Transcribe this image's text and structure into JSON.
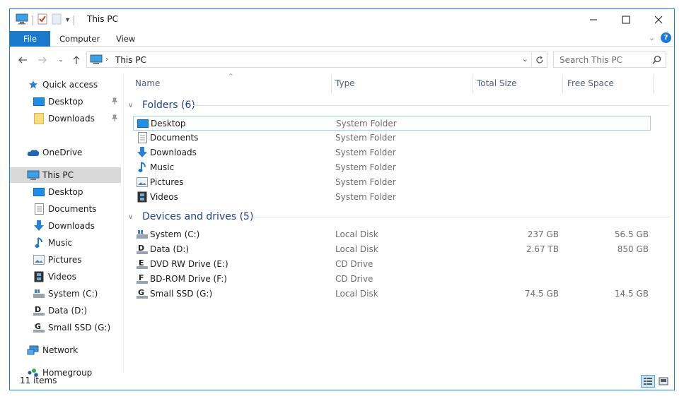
{
  "window": {
    "title": "This PC"
  },
  "ribbon": {
    "tabs": [
      "File",
      "Computer",
      "View"
    ]
  },
  "address": {
    "location": "This PC",
    "search_placeholder": "Search This PC"
  },
  "nav": {
    "items": [
      {
        "label": "Quick access",
        "icon": "star-icon"
      },
      {
        "label": "Desktop",
        "icon": "desktop-folder-icon",
        "pinned": true
      },
      {
        "label": "Downloads",
        "icon": "folder-icon",
        "pinned": true
      },
      {
        "label": "OneDrive",
        "icon": "cloud-icon"
      },
      {
        "label": "This PC",
        "icon": "computer-icon",
        "selected": true
      },
      {
        "label": "Desktop",
        "icon": "desktop-folder-icon"
      },
      {
        "label": "Documents",
        "icon": "documents-icon"
      },
      {
        "label": "Downloads",
        "icon": "download-arrow-icon"
      },
      {
        "label": "Music",
        "icon": "music-note-icon"
      },
      {
        "label": "Pictures",
        "icon": "pictures-icon"
      },
      {
        "label": "Videos",
        "icon": "film-icon"
      },
      {
        "label": "System (C:)",
        "icon": "system-drive-icon"
      },
      {
        "label": "Data (D:)",
        "icon": "drive-d-icon"
      },
      {
        "label": "Small SSD (G:)",
        "icon": "drive-g-icon"
      },
      {
        "label": "Network",
        "icon": "network-icon"
      },
      {
        "label": "Homegroup",
        "icon": "homegroup-icon"
      }
    ]
  },
  "columns": {
    "name": "Name",
    "type": "Type",
    "total_size": "Total Size",
    "free_space": "Free Space"
  },
  "groups": {
    "folders": {
      "title": "Folders (6)",
      "items": [
        {
          "name": "Desktop",
          "type": "System Folder",
          "icon": "desktop-folder-icon"
        },
        {
          "name": "Documents",
          "type": "System Folder",
          "icon": "documents-icon"
        },
        {
          "name": "Downloads",
          "type": "System Folder",
          "icon": "download-arrow-icon"
        },
        {
          "name": "Music",
          "type": "System Folder",
          "icon": "music-note-icon"
        },
        {
          "name": "Pictures",
          "type": "System Folder",
          "icon": "pictures-icon"
        },
        {
          "name": "Videos",
          "type": "System Folder",
          "icon": "film-icon"
        }
      ]
    },
    "drives": {
      "title": "Devices and drives (5)",
      "items": [
        {
          "name": "System (C:)",
          "type": "Local Disk",
          "total": "237 GB",
          "free": "56.5 GB",
          "icon": "system-drive-icon"
        },
        {
          "name": "Data (D:)",
          "type": "Local Disk",
          "total": "2.67 TB",
          "free": "850 GB",
          "icon": "drive-d-icon"
        },
        {
          "name": "DVD RW Drive (E:)",
          "type": "CD Drive",
          "total": "",
          "free": "",
          "icon": "drive-e-icon"
        },
        {
          "name": "BD-ROM Drive (F:)",
          "type": "CD Drive",
          "total": "",
          "free": "",
          "icon": "drive-f-icon"
        },
        {
          "name": "Small SSD (G:)",
          "type": "Local Disk",
          "total": "74.5 GB",
          "free": "14.5 GB",
          "icon": "drive-g-icon"
        }
      ]
    }
  },
  "status": {
    "count": "11 items"
  },
  "colors": {
    "accent": "#1979ca",
    "group_header": "#1e3e92",
    "selected_bg": "#d9d9d9"
  }
}
